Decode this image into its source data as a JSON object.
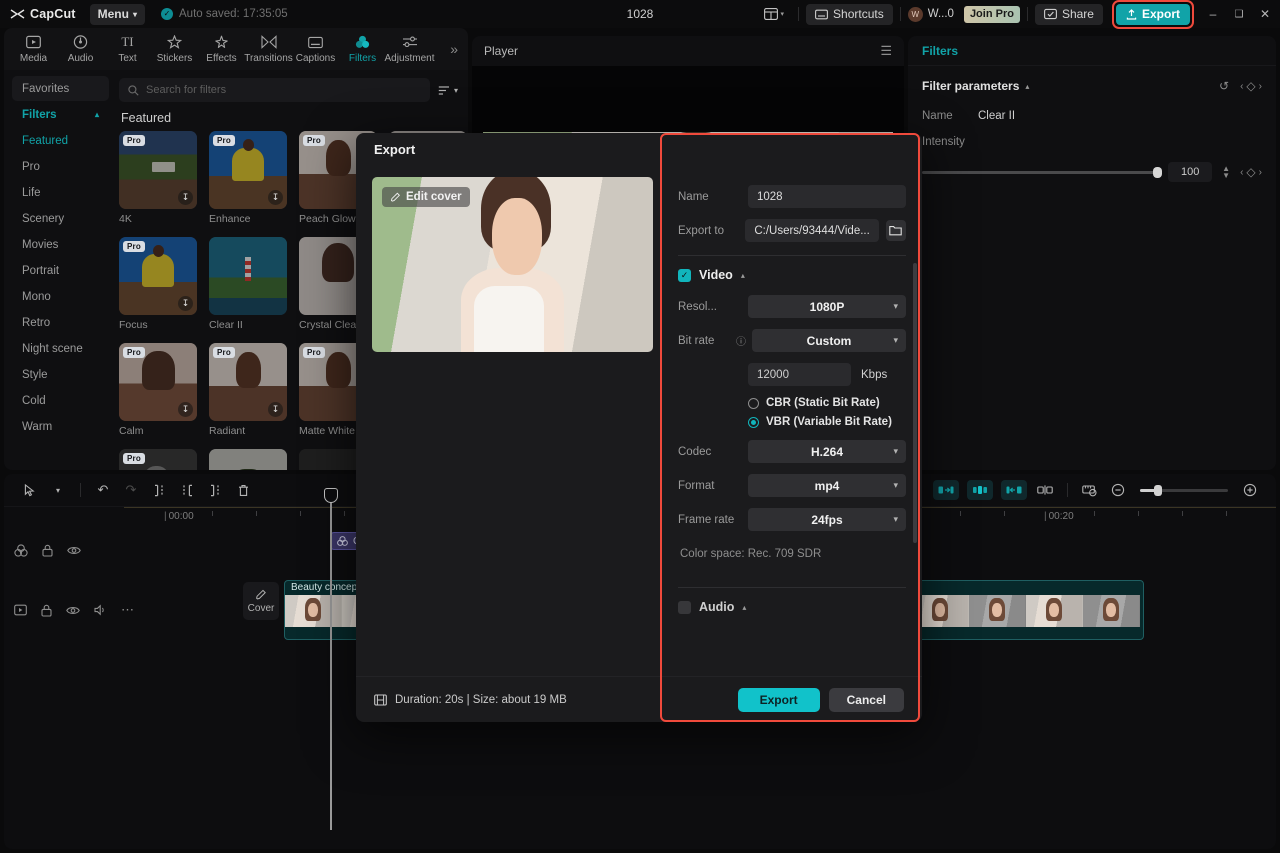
{
  "titlebar": {
    "brand": "CapCut",
    "menu_label": "Menu",
    "autosave_text": "Auto saved: 17:35:05",
    "project_title": "1028",
    "shortcuts_label": "Shortcuts",
    "account_initial": "W",
    "account_name": "W...0",
    "join_pro_label": "Join Pro",
    "share_label": "Share",
    "export_label": "Export",
    "minimize_glyph": "–",
    "maximize_glyph": "❐",
    "close_glyph": "✕",
    "accent_teal": "#11a3a8",
    "highlight_red": "#f04a3c"
  },
  "navbar": {
    "items": [
      {
        "label": "Media",
        "icon": "media-icon"
      },
      {
        "label": "Audio",
        "icon": "audio-icon"
      },
      {
        "label": "Text",
        "icon": "text-icon"
      },
      {
        "label": "Stickers",
        "icon": "stickers-icon"
      },
      {
        "label": "Effects",
        "icon": "effects-icon"
      },
      {
        "label": "Transitions",
        "icon": "transitions-icon"
      },
      {
        "label": "Captions",
        "icon": "captions-icon"
      },
      {
        "label": "Filters",
        "icon": "filters-icon"
      },
      {
        "label": "Adjustment",
        "icon": "adjustment-icon"
      }
    ],
    "active_index": 7,
    "more_glyph": "»"
  },
  "left_panel": {
    "categories": [
      {
        "label": "Favorites",
        "style": "selected"
      },
      {
        "label": "Filters",
        "style": "group"
      },
      {
        "label": "Featured",
        "style": "featured"
      },
      {
        "label": "Pro",
        "style": "plain"
      },
      {
        "label": "Life",
        "style": "plain"
      },
      {
        "label": "Scenery",
        "style": "plain"
      },
      {
        "label": "Movies",
        "style": "plain"
      },
      {
        "label": "Portrait",
        "style": "plain"
      },
      {
        "label": "Mono",
        "style": "plain"
      },
      {
        "label": "Retro",
        "style": "plain"
      },
      {
        "label": "Night scene",
        "style": "plain"
      },
      {
        "label": "Style",
        "style": "plain"
      },
      {
        "label": "Cold",
        "style": "plain"
      },
      {
        "label": "Warm",
        "style": "plain"
      }
    ],
    "search_placeholder": "Search for filters",
    "section_title": "Featured",
    "thumbnails": [
      {
        "label": "4K",
        "pro": true,
        "download": true,
        "art": "a-forest"
      },
      {
        "label": "Enhance",
        "pro": true,
        "download": true,
        "art": "a-yellow"
      },
      {
        "label": "Peach Glow",
        "pro": true,
        "download": false,
        "art": "a-portrait"
      },
      {
        "label": "",
        "pro": false,
        "download": false,
        "art": "a-portrait2"
      },
      {
        "label": "Focus",
        "pro": true,
        "download": true,
        "art": "a-yellow"
      },
      {
        "label": "Clear II",
        "pro": false,
        "download": false,
        "art": "a-light"
      },
      {
        "label": "Crystal Clear",
        "pro": false,
        "download": false,
        "art": "a-portrait2"
      },
      {
        "label": "",
        "pro": false,
        "download": false,
        "art": "a-skin"
      },
      {
        "label": "Calm",
        "pro": true,
        "download": true,
        "art": "a-skin"
      },
      {
        "label": "Radiant",
        "pro": true,
        "download": true,
        "art": "a-portrait"
      },
      {
        "label": "Matte White",
        "pro": true,
        "download": false,
        "art": "a-portrait"
      },
      {
        "label": "",
        "pro": false,
        "download": false,
        "art": "a-skin"
      },
      {
        "label": "",
        "pro": true,
        "download": false,
        "art": "a-bw"
      },
      {
        "label": "",
        "pro": false,
        "download": false,
        "art": "a-tree"
      },
      {
        "label": "",
        "pro": false,
        "download": false,
        "art": "a-dark"
      },
      {
        "label": "",
        "pro": false,
        "download": false,
        "art": "a-dark"
      }
    ]
  },
  "player": {
    "title": "Player",
    "menu_glyph": "☰"
  },
  "right_panel": {
    "tab_label": "Filters",
    "section_title": "Filter parameters",
    "reset_glyph": "↺",
    "keyframe_prev": "‹",
    "keyframe_mark": "◇",
    "keyframe_next": "›",
    "name_label": "Name",
    "name_value": "Clear II",
    "intensity_label": "Intensity",
    "intensity_value": "100"
  },
  "timeline": {
    "tool_select": "select-tool",
    "undo_glyph": "↶",
    "redo_glyph": "↷",
    "split_glyph": "][",
    "trim_left_glyph": "][",
    "trim_right_glyph": "][",
    "delete_glyph": "Ὕ1",
    "ruler_labels": [
      "00:00",
      "00:20"
    ],
    "cover_label": "Cover",
    "clip_title": "Beauty concept of young asian woman.",
    "filter_clip_label": "Clear II"
  },
  "export_dialog": {
    "title": "Export",
    "edit_cover_label": "Edit cover",
    "name_label": "Name",
    "name_value": "1028",
    "export_to_label": "Export to",
    "export_to_value": "C:/Users/93444/Vide...",
    "video_section_label": "Video",
    "video_checked": true,
    "resolution_label": "Resol...",
    "resolution_value": "1080P",
    "bitrate_label": "Bit rate",
    "bitrate_value": "Custom",
    "bitrate_number": "12000",
    "bitrate_unit": "Kbps",
    "cbr_label": "CBR (Static Bit Rate)",
    "vbr_label": "VBR (Variable Bit Rate)",
    "bitrate_mode": "vbr",
    "codec_label": "Codec",
    "codec_value": "H.264",
    "format_label": "Format",
    "format_value": "mp4",
    "framerate_label": "Frame rate",
    "framerate_value": "24fps",
    "colorspace_text": "Color space: Rec. 709 SDR",
    "audio_section_label": "Audio",
    "audio_checked": false,
    "duration_text": "Duration: 20s | Size: about 19 MB",
    "export_button": "Export",
    "cancel_button": "Cancel"
  }
}
